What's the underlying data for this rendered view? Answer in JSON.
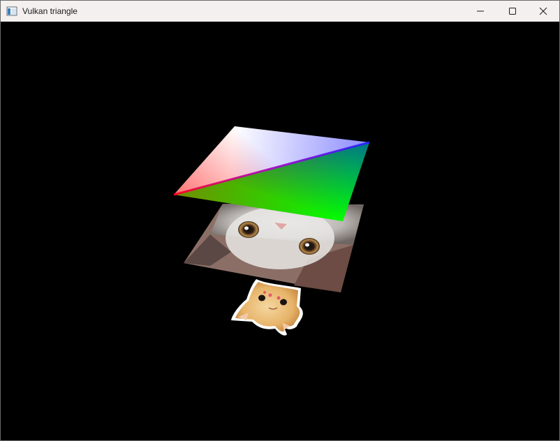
{
  "window": {
    "title": "Vulkan triangle",
    "titlebar_color": "#f3f0ef",
    "controls": [
      "minimize-icon",
      "maximize-icon",
      "close-icon"
    ]
  },
  "viewport": {
    "background": "#000000",
    "objects": [
      {
        "name": "vertex-color-quad",
        "colors": [
          "#ffffff",
          "#0000ff",
          "#00ff00",
          "#ff0000"
        ]
      },
      {
        "name": "gray-cat-textured-quad"
      },
      {
        "name": "orange-cat-sticker"
      }
    ]
  }
}
